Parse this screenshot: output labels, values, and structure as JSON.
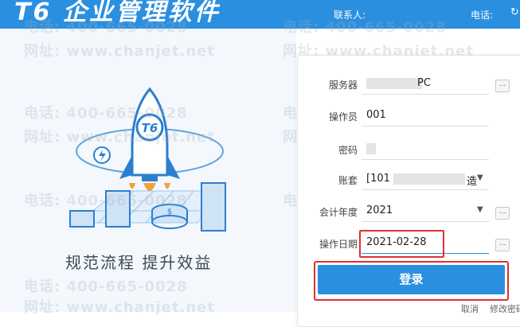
{
  "header": {
    "logo": "T6 企业管理软件",
    "contact_label": "联系人:",
    "phone_label": "电话:",
    "refresh_icon": "refresh-icon"
  },
  "left": {
    "slogan": "规范流程  提升效益"
  },
  "watermark": {
    "phone": "电话: 400-665-0028",
    "site": "网址: www.chanjet.net"
  },
  "login": {
    "server_label": "服务器",
    "server_value": "PC",
    "operator_label": "操作员",
    "operator_value": "001",
    "password_label": "密码",
    "account_label": "账套",
    "account_value": "[101",
    "account_suffix": "造",
    "year_label": "会计年度",
    "year_value": "2021",
    "date_label": "操作日期",
    "date_value": "2021-02-28",
    "login_button": "登录",
    "cancel_link": "取消",
    "change_password_link": "修改密码",
    "more_button": "..."
  }
}
